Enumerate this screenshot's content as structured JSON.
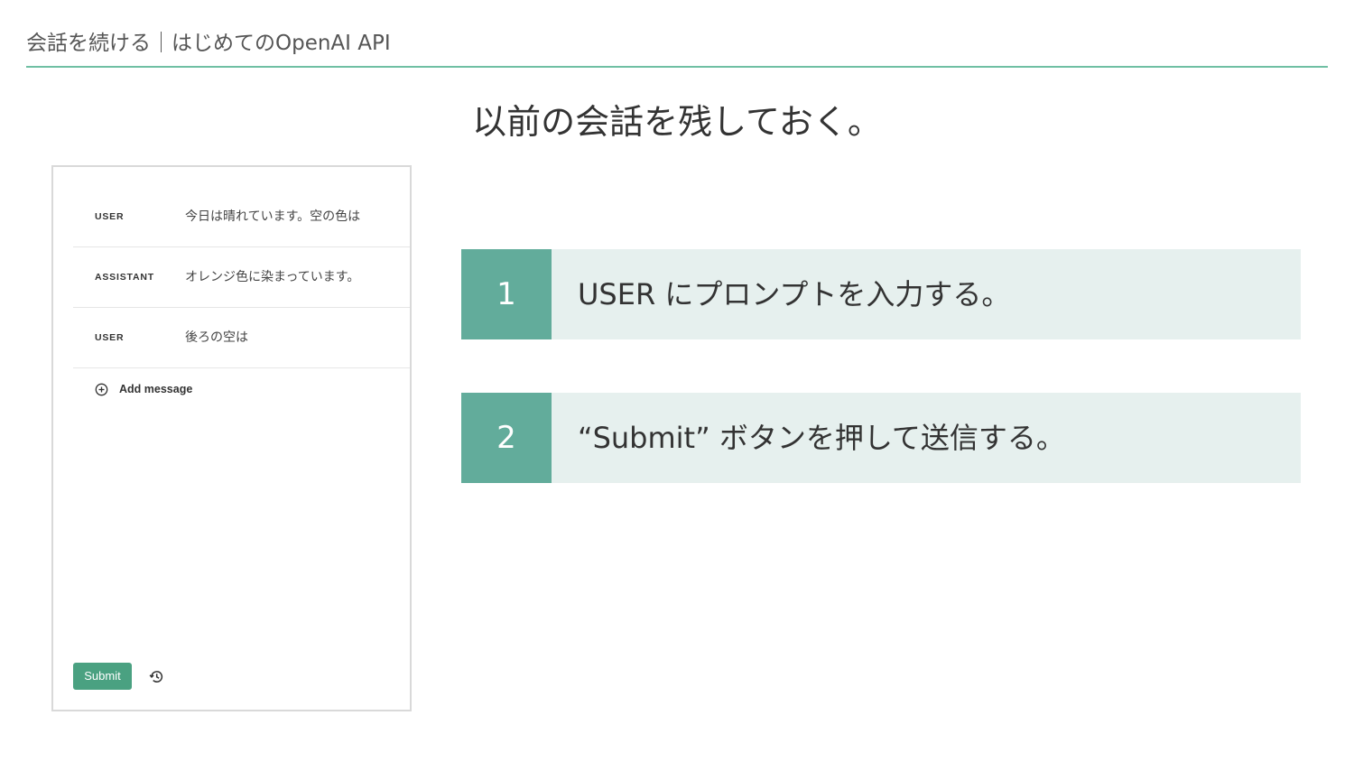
{
  "header": {
    "title": "会話を続ける｜はじめてのOpenAI API"
  },
  "main_title": "以前の会話を残しておく。",
  "playground": {
    "messages": [
      {
        "role": "USER",
        "text": "今日は晴れています。空の色は"
      },
      {
        "role": "ASSISTANT",
        "text": "オレンジ色に染まっています。"
      },
      {
        "role": "USER",
        "text": "後ろの空は"
      }
    ],
    "add_message_label": "Add message",
    "submit_label": "Submit",
    "icons": {
      "add": "plus-circle-icon",
      "history": "history-icon"
    }
  },
  "steps": [
    {
      "number": "1",
      "text": "USER にプロンプトを入力する。"
    },
    {
      "number": "2",
      "text": "“Submit” ボタンを押して送信する。"
    }
  ],
  "colors": {
    "accent": "#62ac9b",
    "accent_light": "#e6f0ee",
    "header_rule": "#6fbfa3",
    "submit_button": "#4aa181"
  }
}
